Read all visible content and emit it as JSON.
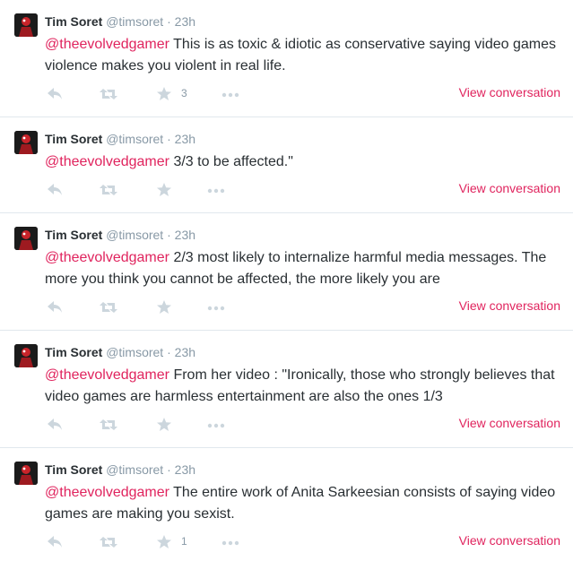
{
  "accent_color": "#e0245e",
  "icons": {
    "reply": "reply-icon",
    "retweet": "retweet-icon",
    "favorite": "star-icon",
    "more": "more-icon"
  },
  "tweets": [
    {
      "author": "Tim Soret",
      "handle": "@timsoret",
      "time": "23h",
      "mention": "@theevolvedgamer",
      "text": "This is as toxic & idiotic as conservative saying video games violence makes you violent in real life.",
      "fav_count": "3",
      "view_conversation": "View conversation"
    },
    {
      "author": "Tim Soret",
      "handle": "@timsoret",
      "time": "23h",
      "mention": "@theevolvedgamer",
      "text": "3/3 to be affected.\"",
      "fav_count": "",
      "view_conversation": "View conversation"
    },
    {
      "author": "Tim Soret",
      "handle": "@timsoret",
      "time": "23h",
      "mention": "@theevolvedgamer",
      "text": "2/3 most likely to internalize harmful media messages. The more you think you cannot be affected, the more likely you are",
      "fav_count": "",
      "view_conversation": "View conversation"
    },
    {
      "author": "Tim Soret",
      "handle": "@timsoret",
      "time": "23h",
      "mention": "@theevolvedgamer",
      "text": "From her video : \"Ironically, those who strongly believes that video games are harmless entertainment are also the ones 1/3",
      "fav_count": "",
      "view_conversation": "View conversation"
    },
    {
      "author": "Tim Soret",
      "handle": "@timsoret",
      "time": "23h",
      "mention": "@theevolvedgamer",
      "text": "The entire work of Anita Sarkeesian consists of saying video games are making you sexist.",
      "fav_count": "1",
      "view_conversation": "View conversation"
    }
  ]
}
